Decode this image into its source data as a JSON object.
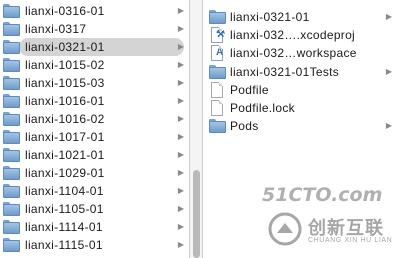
{
  "left_column": {
    "items": [
      {
        "label": "lianxi-0316-01",
        "icon": "folder-icon"
      },
      {
        "label": "lianxi-0317",
        "icon": "folder-icon"
      },
      {
        "label": "lianxi-0321-01",
        "icon": "folder-icon",
        "selected": true
      },
      {
        "label": "lianxi-1015-02",
        "icon": "folder-icon"
      },
      {
        "label": "lianxi-1015-03",
        "icon": "folder-icon"
      },
      {
        "label": "lianxi-1016-01",
        "icon": "folder-icon"
      },
      {
        "label": "lianxi-1016-02",
        "icon": "folder-icon"
      },
      {
        "label": "lianxi-1017-01",
        "icon": "folder-icon"
      },
      {
        "label": "lianxi-1021-01",
        "icon": "folder-icon"
      },
      {
        "label": "lianxi-1029-01",
        "icon": "folder-icon"
      },
      {
        "label": "lianxi-1104-01",
        "icon": "folder-icon"
      },
      {
        "label": "lianxi-1105-01",
        "icon": "folder-icon"
      },
      {
        "label": "lianxi-1114-01",
        "icon": "folder-icon"
      },
      {
        "label": "lianxi-1115-01",
        "icon": "folder-icon"
      }
    ]
  },
  "right_column": {
    "items": [
      {
        "label": "lianxi-0321-01",
        "icon": "folder-icon",
        "expandable": true
      },
      {
        "label": "lianxi-032….xcodeproj",
        "icon": "xcodeproj-icon",
        "expandable": false
      },
      {
        "label": "lianxi-032…workspace",
        "icon": "xcworkspace-icon",
        "expandable": false
      },
      {
        "label": "lianxi-0321-01Tests",
        "icon": "folder-icon",
        "expandable": true
      },
      {
        "label": "Podfile",
        "icon": "file-icon",
        "expandable": false
      },
      {
        "label": "Podfile.lock",
        "icon": "file-icon",
        "expandable": false
      },
      {
        "label": "Pods",
        "icon": "folder-icon",
        "expandable": true
      }
    ]
  },
  "watermark": {
    "text": "51CTO.com",
    "logo_cn": "创新互联",
    "logo_en": "CHUANG XIN HU LIAN"
  },
  "colors": {
    "folder": "#8db5dc",
    "selection": "#d4d4d4",
    "arrow": "#8a8a8a"
  }
}
